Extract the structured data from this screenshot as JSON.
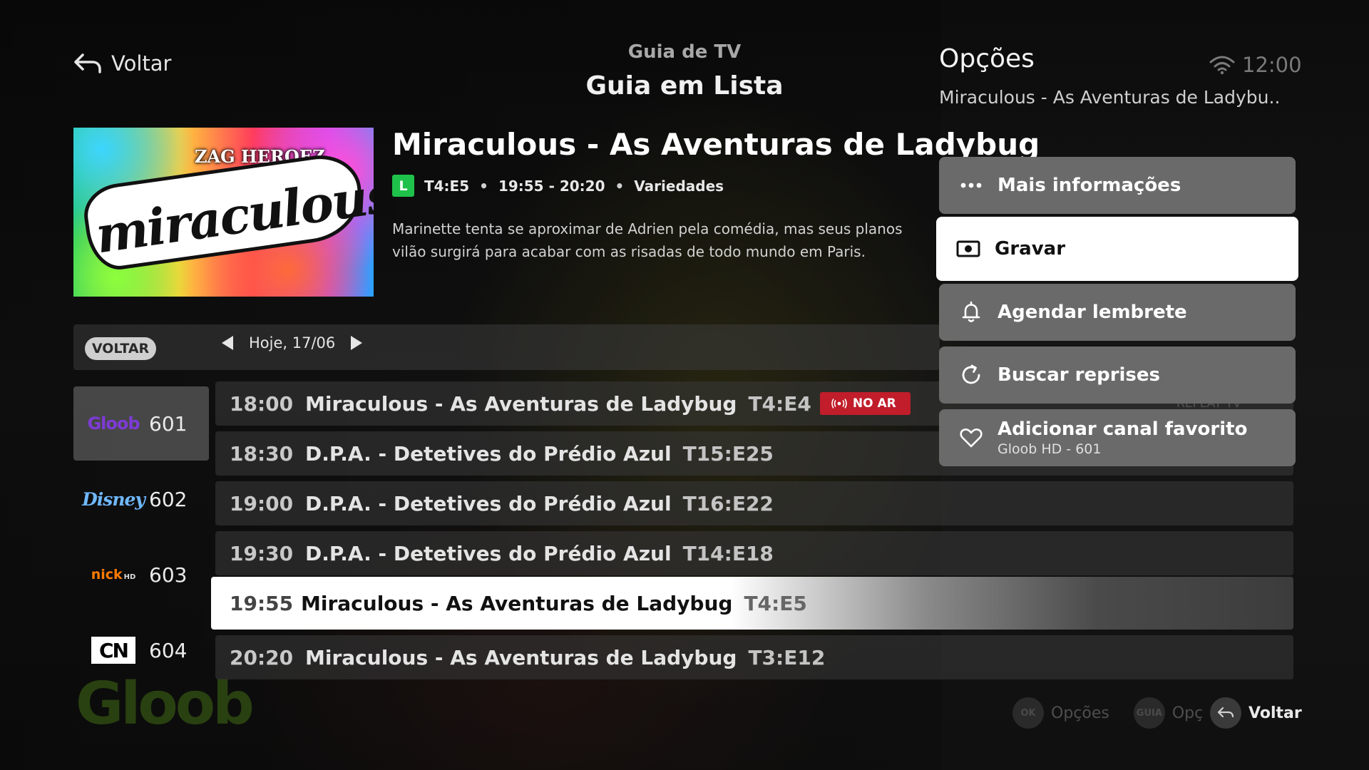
{
  "header": {
    "back_label": "Voltar",
    "subtitle": "Guia de TV",
    "title": "Guia em Lista"
  },
  "program": {
    "title": "Miraculous - As Aventuras de Ladybug",
    "rating": "L",
    "episode": "T4:E5",
    "time": "19:55 - 20:20",
    "genre": "Variedades",
    "description_line1": "Marinette tenta se aproximar de Adrien pela comédia, mas seus planos",
    "description_line2": "vilão surgirá para acabar com as risadas de todo mundo em Paris.",
    "poster": {
      "brand": "ZAG HEROEZ",
      "logo": "miraculous"
    }
  },
  "datebar": {
    "back_chip": "VOLTAR",
    "date": "Hoje, 17/06"
  },
  "channels": [
    {
      "logo": "Gloob",
      "logo_icon": "gloob-logo",
      "number": "601",
      "color": "#7d3bd6"
    },
    {
      "logo": "Disney",
      "logo_icon": "disney-logo",
      "number": "602",
      "color": "#6fb8ff"
    },
    {
      "logo": "nick",
      "logo_sub": "HD",
      "logo_icon": "nick-logo",
      "number": "603",
      "color": "#ff7a00"
    },
    {
      "logo": "CN",
      "logo_icon": "cartoon-network-logo",
      "number": "604",
      "color": "#ffffff"
    }
  ],
  "watermark": "Gloob",
  "schedule": [
    {
      "time": "18:00",
      "title": "Miraculous - As Aventuras de Ladybug",
      "episode": "T4:E4",
      "badge": "NO AR"
    },
    {
      "time": "18:30",
      "title": "D.P.A. - Detetives do Prédio Azul",
      "episode": "T15:E25"
    },
    {
      "time": "19:00",
      "title": "D.P.A. - Detetives do Prédio Azul",
      "episode": "T16:E22"
    },
    {
      "time": "19:30",
      "title": "D.P.A. - Detetives do Prédio Azul",
      "episode": "T14:E18"
    },
    {
      "time": "19:55",
      "title": "Miraculous - As Aventuras de Ladybug",
      "episode": "T4:E5",
      "selected": true
    },
    {
      "time": "20:20",
      "title": "Miraculous - As Aventuras de Ladybug",
      "episode": "T3:E12"
    }
  ],
  "options": {
    "heading": "Opções",
    "program_name": "Miraculous - As Aventuras de Ladybu..",
    "items": [
      {
        "label": "Mais informações",
        "icon": "more-dots-icon"
      },
      {
        "label": "Gravar",
        "icon": "record-icon",
        "selected": true
      },
      {
        "label": "Agendar lembrete",
        "icon": "bell-icon"
      },
      {
        "label": "Buscar reprises",
        "icon": "refresh-icon"
      },
      {
        "label": "Adicionar canal favorito",
        "sublabel": "Gloob HD - 601",
        "icon": "heart-icon"
      }
    ]
  },
  "status": {
    "clock": "12:00",
    "icon": "wifi-icon"
  },
  "hints": {
    "ok_key": "OK",
    "ok_label": "Opções",
    "guide_key": "GUIA",
    "guide_label": "Opç",
    "back_label": "Voltar",
    "ghost": "REPLAY TV"
  },
  "colors": {
    "live_badge": "#c11d2a",
    "rating_badge": "#1ec24a",
    "option_button": "#6a6a6a",
    "selected": "#ffffff"
  }
}
